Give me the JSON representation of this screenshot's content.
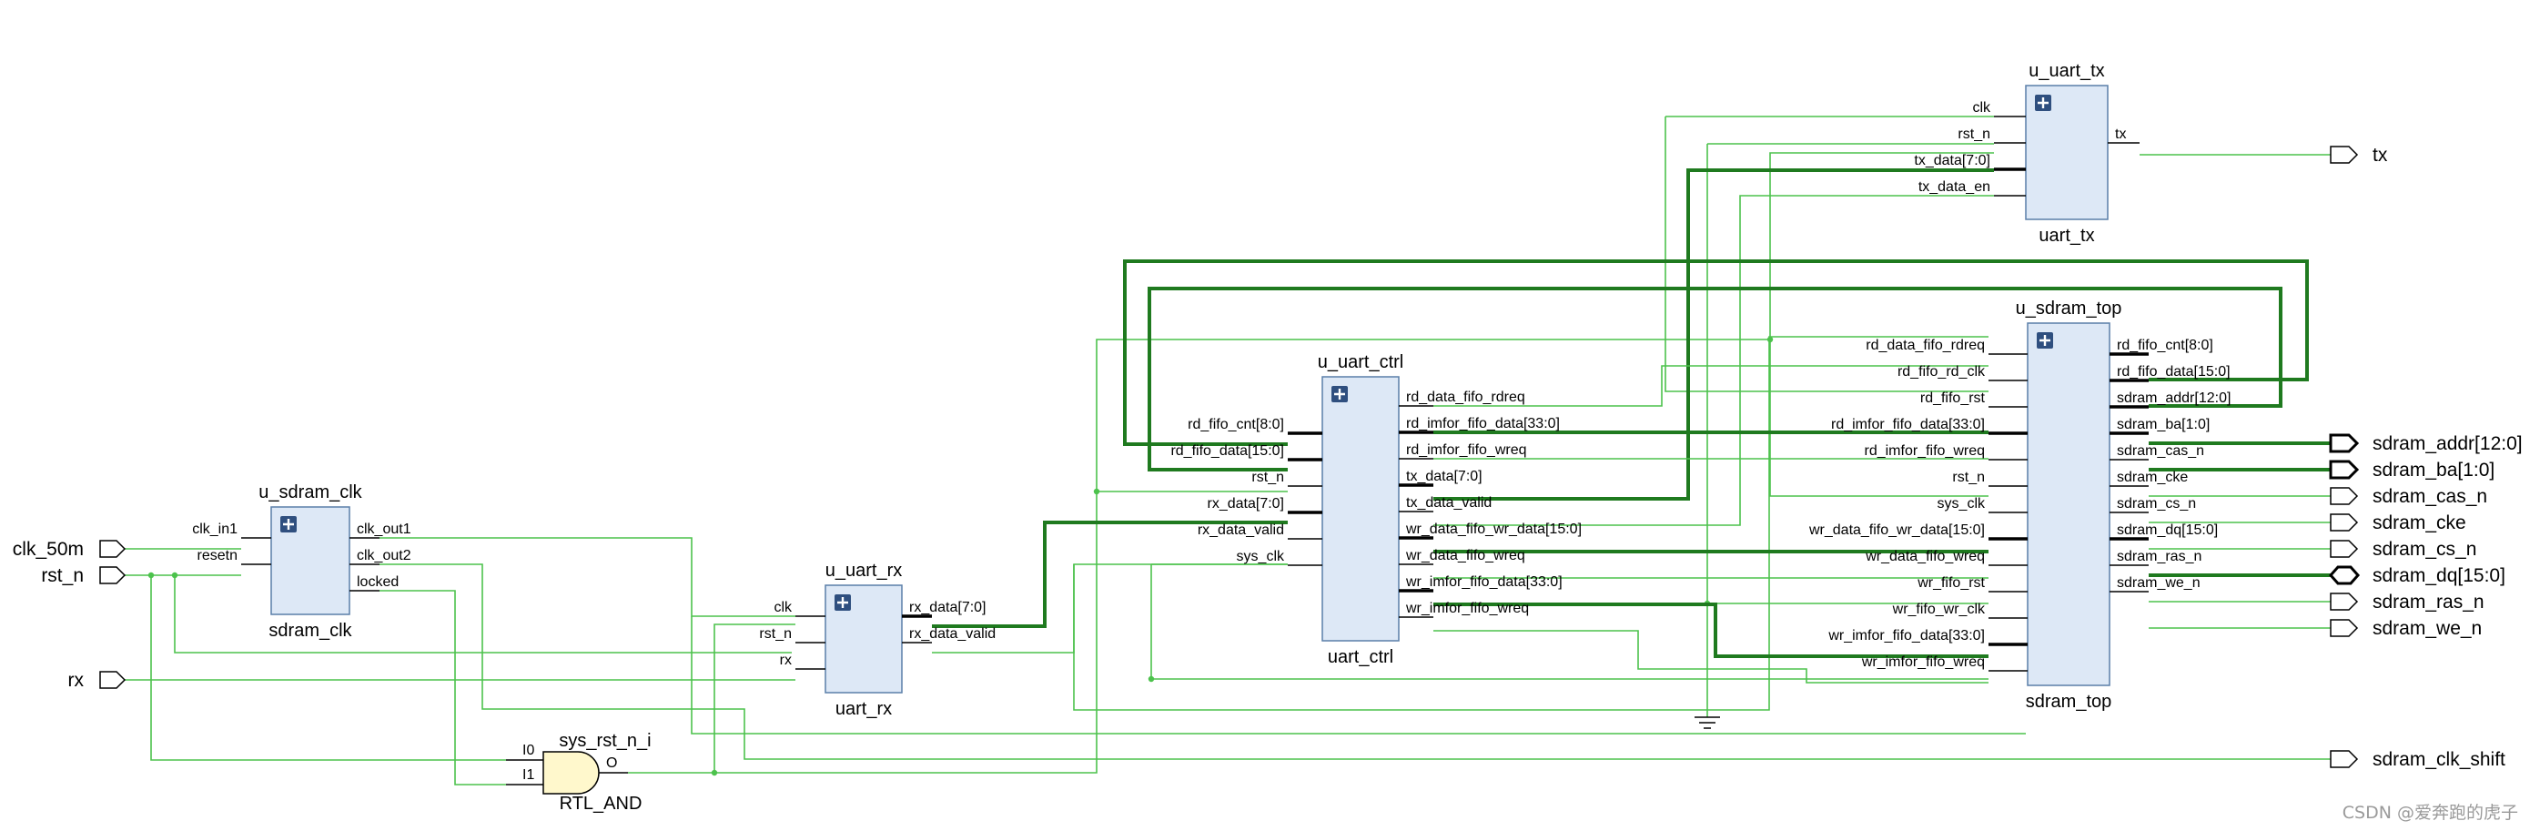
{
  "watermark": "CSDN @爱奔跑的虎子",
  "colors": {
    "net": "#4cc24c",
    "bus": "#1f7a1f",
    "block_fill": "#dde8f6",
    "block_border": "#5a7fa8",
    "gate_fill": "#fff8cc"
  },
  "ports": {
    "inputs": [
      "clk_50m",
      "rst_n",
      "rx"
    ],
    "outputs": [
      "tx",
      "sdram_addr[12:0]",
      "sdram_ba[1:0]",
      "sdram_cas_n",
      "sdram_cke",
      "sdram_cs_n",
      "sdram_dq[15:0]",
      "sdram_ras_n",
      "sdram_we_n",
      "sdram_clk_shift"
    ]
  },
  "blocks": {
    "sdram_clk": {
      "instance": "u_sdram_clk",
      "module": "sdram_clk",
      "inputs": [
        "clk_in1",
        "resetn"
      ],
      "outputs": [
        "clk_out1",
        "clk_out2",
        "locked"
      ]
    },
    "uart_rx": {
      "instance": "u_uart_rx",
      "module": "uart_rx",
      "inputs": [
        "clk",
        "rst_n",
        "rx"
      ],
      "outputs": [
        "rx_data[7:0]",
        "rx_data_valid"
      ]
    },
    "uart_ctrl": {
      "instance": "u_uart_ctrl",
      "module": "uart_ctrl",
      "inputs": [
        "rd_fifo_cnt[8:0]",
        "rd_fifo_data[15:0]",
        "rst_n",
        "rx_data[7:0]",
        "rx_data_valid",
        "sys_clk"
      ],
      "outputs": [
        "rd_data_fifo_rdreq",
        "rd_imfor_fifo_data[33:0]",
        "rd_imfor_fifo_wreq",
        "tx_data[7:0]",
        "tx_data_valid",
        "wr_data_fifo_wr_data[15:0]",
        "wr_data_fifo_wreq",
        "wr_imfor_fifo_data[33:0]",
        "wr_imfor_fifo_wreq"
      ]
    },
    "uart_tx": {
      "instance": "u_uart_tx",
      "module": "uart_tx",
      "inputs": [
        "clk",
        "rst_n",
        "tx_data[7:0]",
        "tx_data_en"
      ],
      "outputs": [
        "tx"
      ]
    },
    "sdram_top": {
      "instance": "u_sdram_top",
      "module": "sdram_top",
      "inputs": [
        "rd_data_fifo_rdreq",
        "rd_fifo_rd_clk",
        "rd_fifo_rst",
        "rd_imfor_fifo_data[33:0]",
        "rd_imfor_fifo_wreq",
        "rst_n",
        "sys_clk",
        "wr_data_fifo_wr_data[15:0]",
        "wr_data_fifo_wreq",
        "wr_fifo_rst",
        "wr_fifo_wr_clk",
        "wr_imfor_fifo_data[33:0]",
        "wr_imfor_fifo_wreq"
      ],
      "outputs": [
        "rd_fifo_cnt[8:0]",
        "rd_fifo_data[15:0]",
        "sdram_addr[12:0]",
        "sdram_ba[1:0]",
        "sdram_cas_n",
        "sdram_cke",
        "sdram_cs_n",
        "sdram_dq[15:0]",
        "sdram_ras_n",
        "sdram_we_n"
      ]
    }
  },
  "gate": {
    "instance": "sys_rst_n_i",
    "type": "RTL_AND",
    "inputs": [
      "I0",
      "I1"
    ],
    "output": "O"
  }
}
